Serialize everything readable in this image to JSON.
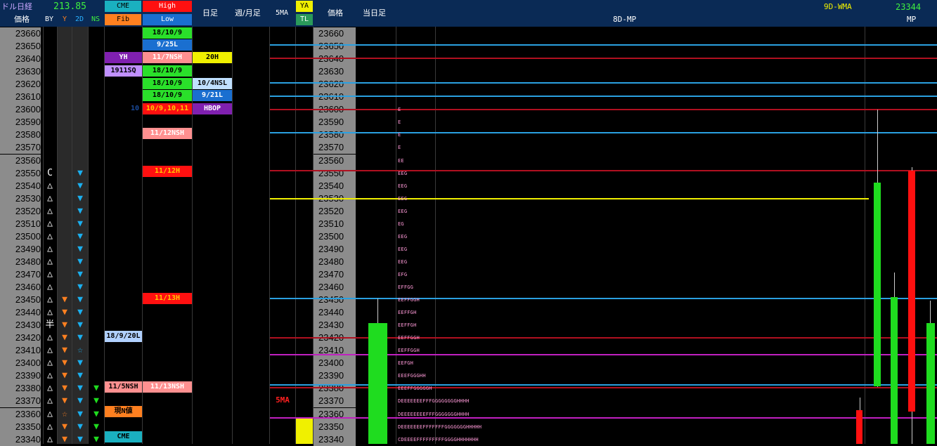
{
  "header": {
    "title": "ドル日経",
    "value": "213.85",
    "price_label": "価格",
    "cols": [
      "BY",
      "Y",
      "2D",
      "NS"
    ],
    "cme": "CME",
    "fib": "Fib",
    "high": "High",
    "low": "Low",
    "daily": "日足",
    "weekly_monthly": "週/月足",
    "ma5": "5MA",
    "ya": "YA",
    "tl": "TL",
    "price_label2": "価格",
    "today": "当日足",
    "mp8d": "8D-MP",
    "wma9d": "9D-WMA",
    "last": "23344",
    "mp": "MP"
  },
  "prices": [
    "23660",
    "23650",
    "23640",
    "23630",
    "23620",
    "23610",
    "23600",
    "23590",
    "23580",
    "23570",
    "23560",
    "23550",
    "23540",
    "23530",
    "23520",
    "23510",
    "23500",
    "23490",
    "23480",
    "23470",
    "23460",
    "23450",
    "23440",
    "23430",
    "23420",
    "23410",
    "23400",
    "23390",
    "23380",
    "23370",
    "23360",
    "23350",
    "23340"
  ],
  "by_marks": [
    "",
    "",
    "",
    "",
    "",
    "",
    "",
    "",
    "",
    "",
    "",
    "C",
    "△",
    "△",
    "△",
    "△",
    "△",
    "△",
    "△",
    "△",
    "△",
    "△",
    "△",
    "半",
    "△",
    "△",
    "△",
    "△",
    "△",
    "△",
    "△",
    "△",
    "△"
  ],
  "labels": {
    "yh": "YH",
    "sq": "1911SQ",
    "fib_1": "18/9/20L",
    "fib_2": "11/5NSH",
    "cme_now": "現N値",
    "cme_bottom": "CME",
    "hl_1": "18/10/9",
    "hl_2": "9/25L",
    "hl_3": "11/7NSH",
    "hl_4": "18/10/9",
    "hl_5": "18/10/9",
    "hl_6": "18/10/9",
    "hl_7": "10/9,10,11",
    "hl_8": "11/12NSH",
    "hl_9": "11/12H",
    "hl_10": "11/13H",
    "hl_11": "11/13NSH",
    "d_1": "20H",
    "d_2": "10/4NSL",
    "d_3": "9/21L",
    "d_4": "HBOP",
    "fib_left": "10",
    "ma5_label": "5MA"
  },
  "tpo": [
    "E",
    "E",
    "E",
    "E",
    "EE",
    "EEG",
    "EEG",
    "EEG",
    "EEG",
    "EG",
    "EEG",
    "EEG",
    "EEG",
    "EFG",
    "EFFGG",
    "EEFFGGH",
    "EEFFGH",
    "EEFFGH",
    "EEFFGGH",
    "EEFFGGH",
    "EEFGH",
    "EEEFGGGHH",
    "EEEFFGGGGGH",
    "DEEEEEEEFFFGGGGGGGGHHHH",
    "DEEEEEEEEFFFGGGGGGGHHHH",
    "DEEEEEEEFFFFFFFGGGGGGGHHHHH",
    "CDEEEEFFFFFFFFFGGGGHHHHHHH"
  ],
  "colors": {
    "header_bg": "#0a2a55",
    "green": "#1fdc1f",
    "red": "#ff1010",
    "blue_line": "#2aa0e0",
    "yellow": "#f0f000",
    "magenta": "#c020c0",
    "darkred": "#b01020",
    "cyan_tri": "#1ab0f0",
    "orange": "#ff8020"
  }
}
